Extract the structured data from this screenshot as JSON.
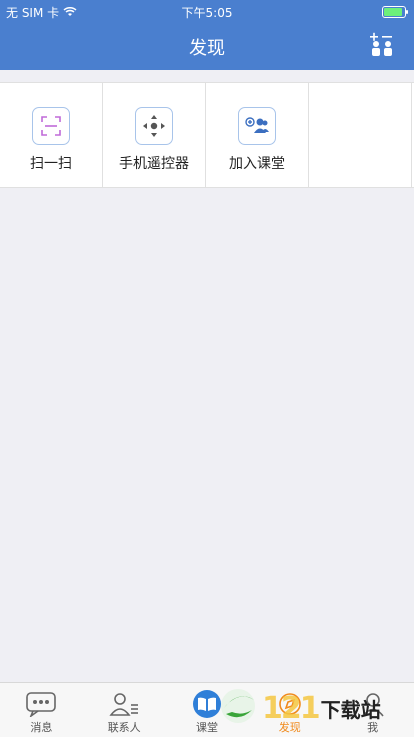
{
  "status": {
    "carrier": "无 SIM 卡",
    "time": "下午5:05"
  },
  "nav": {
    "title": "发现"
  },
  "features": [
    {
      "label": "扫一扫"
    },
    {
      "label": "手机遥控器"
    },
    {
      "label": "加入课堂"
    }
  ],
  "tabs": [
    {
      "label": "消息"
    },
    {
      "label": "联系人"
    },
    {
      "label": "课堂"
    },
    {
      "label": "发现"
    },
    {
      "label": "我"
    }
  ],
  "colors": {
    "primary": "#4a7fcf",
    "active_tab": "#f08a1c"
  },
  "watermark": {
    "logo": "121",
    "site": "下载站"
  }
}
